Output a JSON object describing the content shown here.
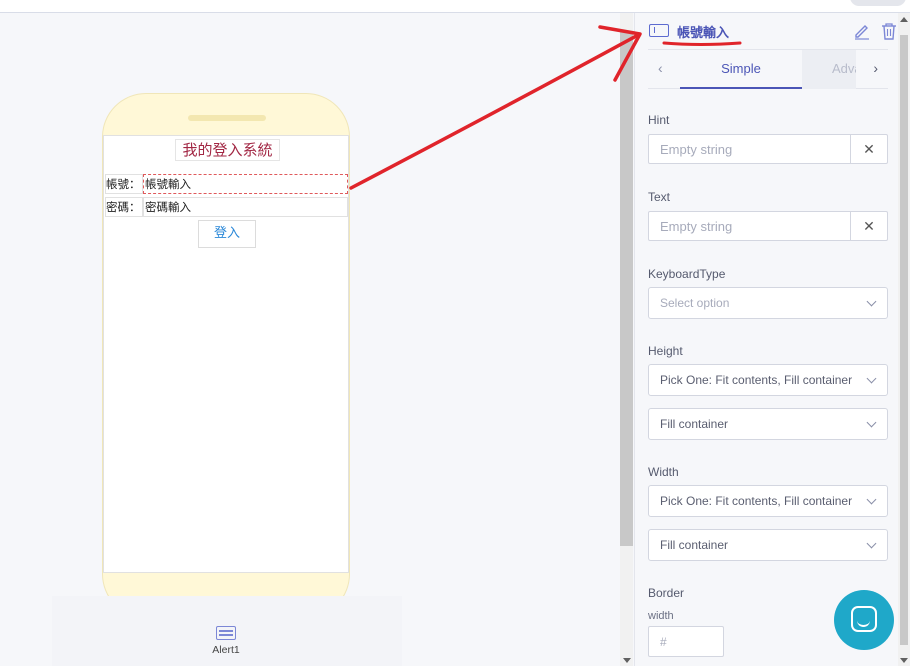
{
  "app": {
    "title": "我的登入系統",
    "account_label": "帳號：",
    "account_input": "帳號輸入",
    "password_label": "密碼：",
    "password_input": "密碼輸入",
    "login_button": "登入"
  },
  "bottom_bar": {
    "alert_label": "Alert1",
    "alert_icon": "alert-dialog-icon"
  },
  "panel": {
    "component_name": "帳號輸入",
    "component_icon": "text-input-icon",
    "edit_icon": "pencil-icon",
    "delete_icon": "trash-icon",
    "tabs": {
      "prev": "‹",
      "simple": "Simple",
      "advanced": "Advanced",
      "next": "›"
    },
    "hint": {
      "label": "Hint",
      "placeholder": "Empty string",
      "clear": "✕"
    },
    "text": {
      "label": "Text",
      "placeholder": "Empty string",
      "clear": "✕"
    },
    "keyboard_type": {
      "label": "KeyboardType",
      "value": "Select option"
    },
    "height": {
      "label": "Height",
      "mode": "Pick One: Fit contents, Fill container",
      "value": "Fill container"
    },
    "width": {
      "label": "Width",
      "mode": "Pick One: Fit contents, Fill container",
      "value": "Fill container"
    },
    "border": {
      "label": "Border",
      "width_label": "width",
      "width_placeholder": "#"
    }
  },
  "colors": {
    "accent": "#4b55b6",
    "annotation": "#e0242b",
    "chat": "#1fa8c9",
    "phone": "#fff8d7"
  }
}
